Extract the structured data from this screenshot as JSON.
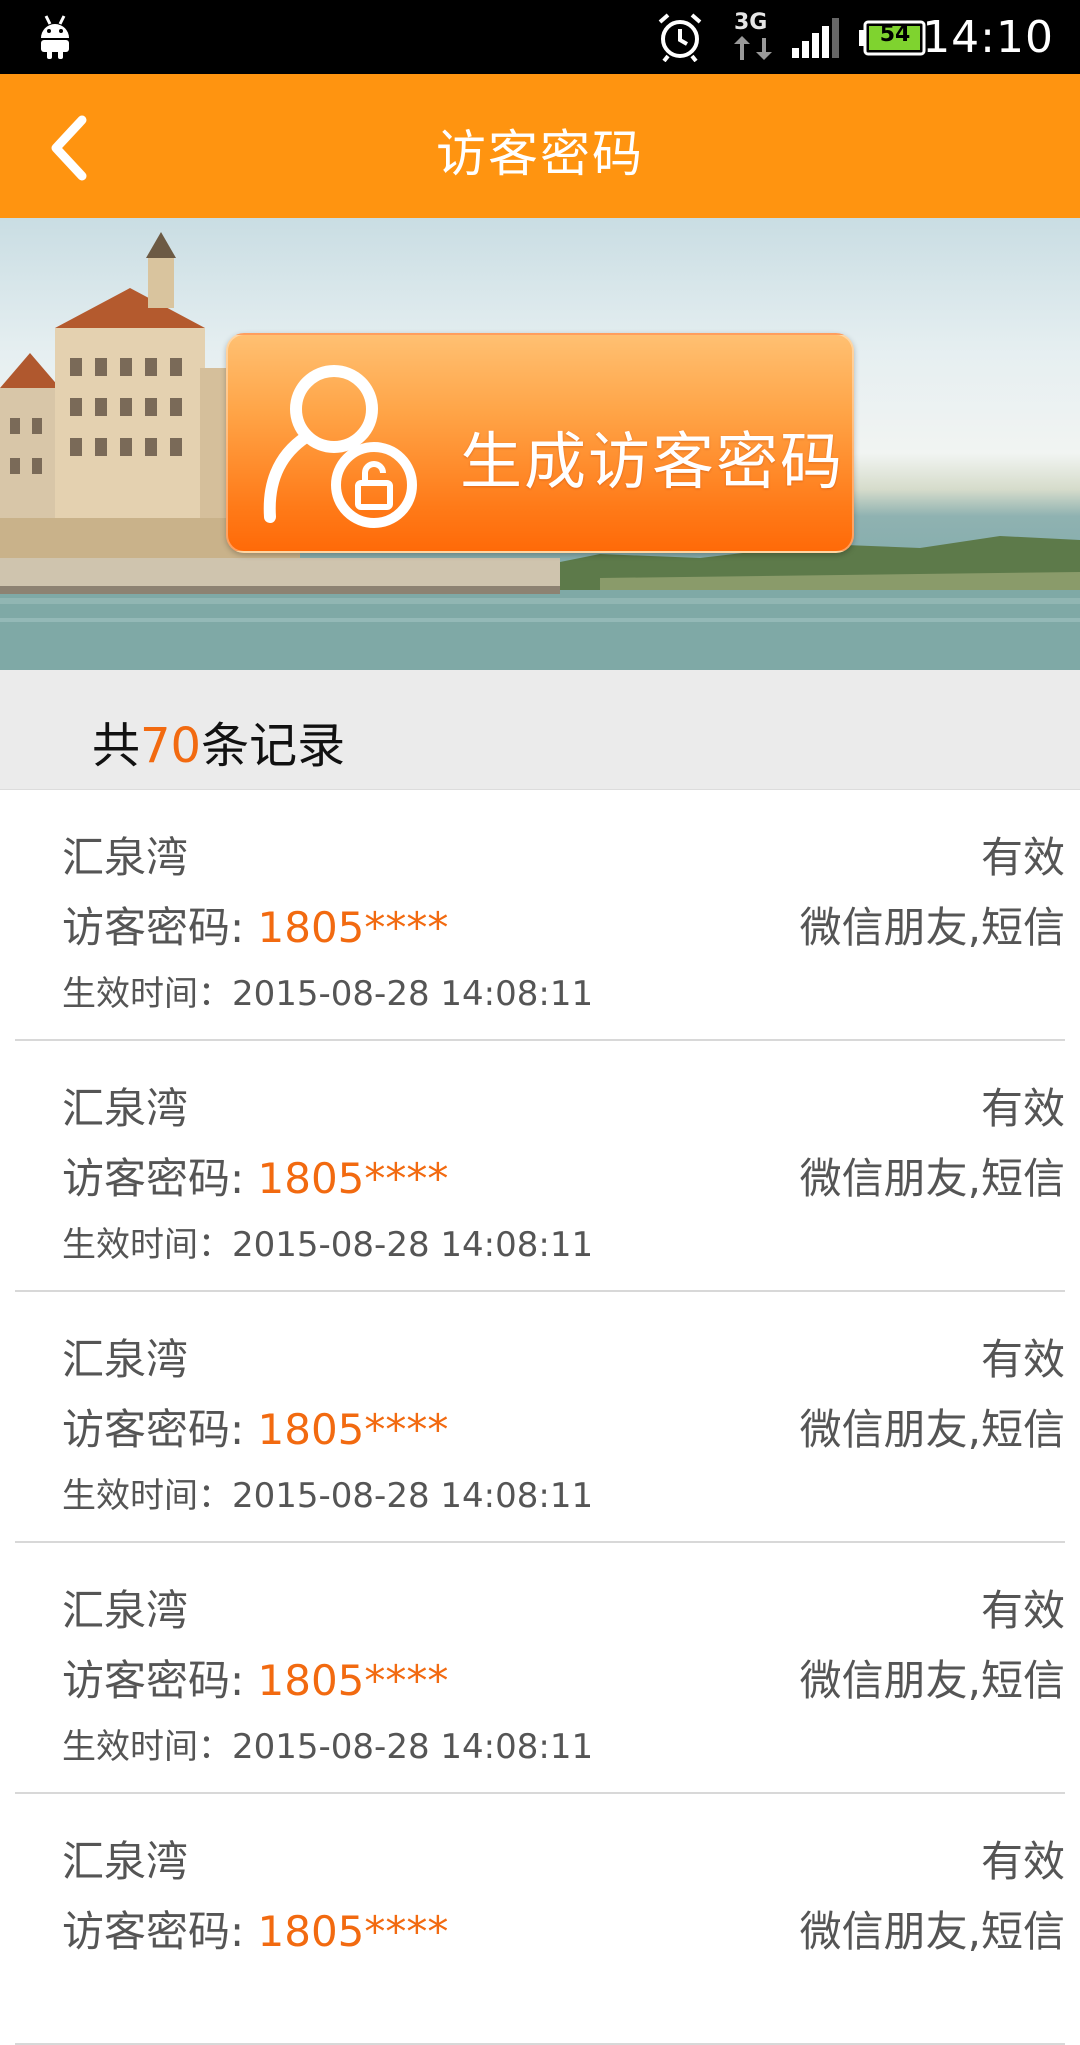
{
  "status_bar": {
    "network": "3G",
    "battery": "54",
    "time": "14:10",
    "icons": [
      "android-icon",
      "alarm-icon",
      "network-3g-icon",
      "signal-icon",
      "battery-icon"
    ]
  },
  "header": {
    "title": "访客密码",
    "back_icon": "chevron-left-icon"
  },
  "banner": {
    "button_label": "生成访客密码",
    "button_icon": "person-lock-icon"
  },
  "summary": {
    "prefix": "共",
    "count": "70",
    "suffix": "条记录"
  },
  "records": [
    {
      "community": "汇泉湾",
      "status": "有效",
      "password_label": "访客密码: ",
      "password": "1805****",
      "channels": "微信朋友,短信",
      "time_label": "生效时间：",
      "time": "2015-08-28 14:08:11"
    },
    {
      "community": "汇泉湾",
      "status": "有效",
      "password_label": "访客密码: ",
      "password": "1805****",
      "channels": "微信朋友,短信",
      "time_label": "生效时间：",
      "time": "2015-08-28 14:08:11"
    },
    {
      "community": "汇泉湾",
      "status": "有效",
      "password_label": "访客密码: ",
      "password": "1805****",
      "channels": "微信朋友,短信",
      "time_label": "生效时间：",
      "time": "2015-08-28 14:08:11"
    },
    {
      "community": "汇泉湾",
      "status": "有效",
      "password_label": "访客密码: ",
      "password": "1805****",
      "channels": "微信朋友,短信",
      "time_label": "生效时间：",
      "time": "2015-08-28 14:08:11"
    },
    {
      "community": "汇泉湾",
      "status": "有效",
      "password_label": "访客密码: ",
      "password": "1805****",
      "channels": "微信朋友,短信",
      "time_label": "",
      "time": ""
    }
  ],
  "colors": {
    "header": "#ff9410",
    "accent": "#f26a10",
    "status_bar": "#000000",
    "count_bg": "#ebebeb"
  }
}
